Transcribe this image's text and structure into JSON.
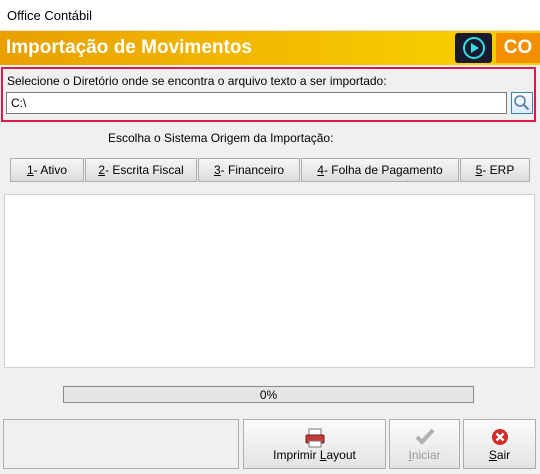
{
  "window": {
    "title": "Office Contábil"
  },
  "banner": {
    "title": "Importação de Movimentos",
    "logo_text": "CO",
    "accent": "#f2b800"
  },
  "directory": {
    "label": "Selecione o Diretório onde se encontra o arquivo texto a ser importado:",
    "value": "C:\\",
    "border_color": "#d81b4a"
  },
  "origin": {
    "label": "Escolha o Sistema Origem da  Importação:",
    "buttons": [
      {
        "key": "1",
        "label": " - Ativo"
      },
      {
        "key": "2",
        "label": " - Escrita Fiscal"
      },
      {
        "key": "3",
        "label": " - Financeiro"
      },
      {
        "key": "4",
        "label": " - Folha de Pagamento"
      },
      {
        "key": "5",
        "label": " - ERP"
      }
    ]
  },
  "progress": {
    "value": 0,
    "text": "0%"
  },
  "footer": {
    "print_layout": {
      "prefix": "Imprimir ",
      "key": "L",
      "rest": "ayout"
    },
    "start": {
      "key": "I",
      "rest": "niciar",
      "enabled": false
    },
    "exit": {
      "key": "S",
      "rest": "air"
    }
  }
}
